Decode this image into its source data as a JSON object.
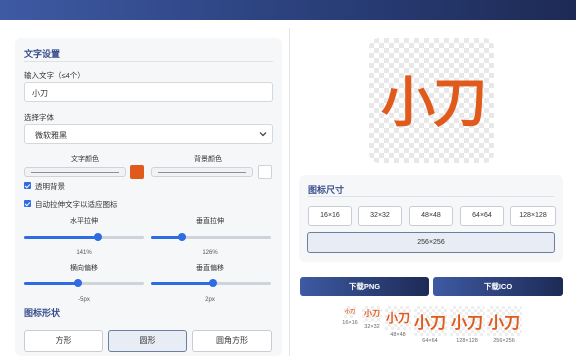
{
  "settings": {
    "title": "文字设置",
    "text_label": "输入文字（≤4个）",
    "text_value": "小刀",
    "font_label": "选择字体",
    "font_value": "微软雅黑",
    "text_color_label": "文字颜色",
    "bg_color_label": "背景颜色",
    "text_color": "#e05a1c",
    "bg_color": "#ffffff",
    "transparent_label": "透明背景",
    "transparent_checked": true,
    "autofit_label": "自动拉伸文字以适应图标",
    "autofit_checked": true,
    "h_stretch_label": "水平拉伸",
    "h_stretch_value": "141%",
    "h_stretch_fraction": 0.62,
    "v_stretch_label": "垂直拉伸",
    "v_stretch_value": "126%",
    "v_stretch_fraction": 0.26,
    "h_offset_label": "横向偏移",
    "h_offset_value": "-5px",
    "h_offset_fraction": 0.45,
    "v_offset_label": "垂直偏移",
    "v_offset_value": "2px",
    "v_offset_fraction": 0.52
  },
  "shape": {
    "title": "图标形状",
    "options": [
      "方形",
      "圆形",
      "圆角方形"
    ],
    "selected": "圆形"
  },
  "preview": {
    "text": "小刀"
  },
  "sizes": {
    "title": "图标尺寸",
    "options": [
      "16×16",
      "32×32",
      "48×48",
      "64×64",
      "128×128",
      "256×256"
    ],
    "selected": "256×256"
  },
  "download": {
    "png_label": "下载PNG",
    "ico_label": "下载ICO"
  },
  "thumbnails": [
    {
      "text": "小刀",
      "caption": "16×16"
    },
    {
      "text": "小刀",
      "caption": "32×32"
    },
    {
      "text": "小刀",
      "caption": "48×48"
    },
    {
      "text": "小刀",
      "caption": "64×64"
    },
    {
      "text": "小刀",
      "caption": "128×128"
    },
    {
      "text": "小刀",
      "caption": "256×256"
    }
  ],
  "colors": {
    "accent": "#2f6be3",
    "brand": "#3a4f8c",
    "icon_text": "#e05a1c"
  }
}
